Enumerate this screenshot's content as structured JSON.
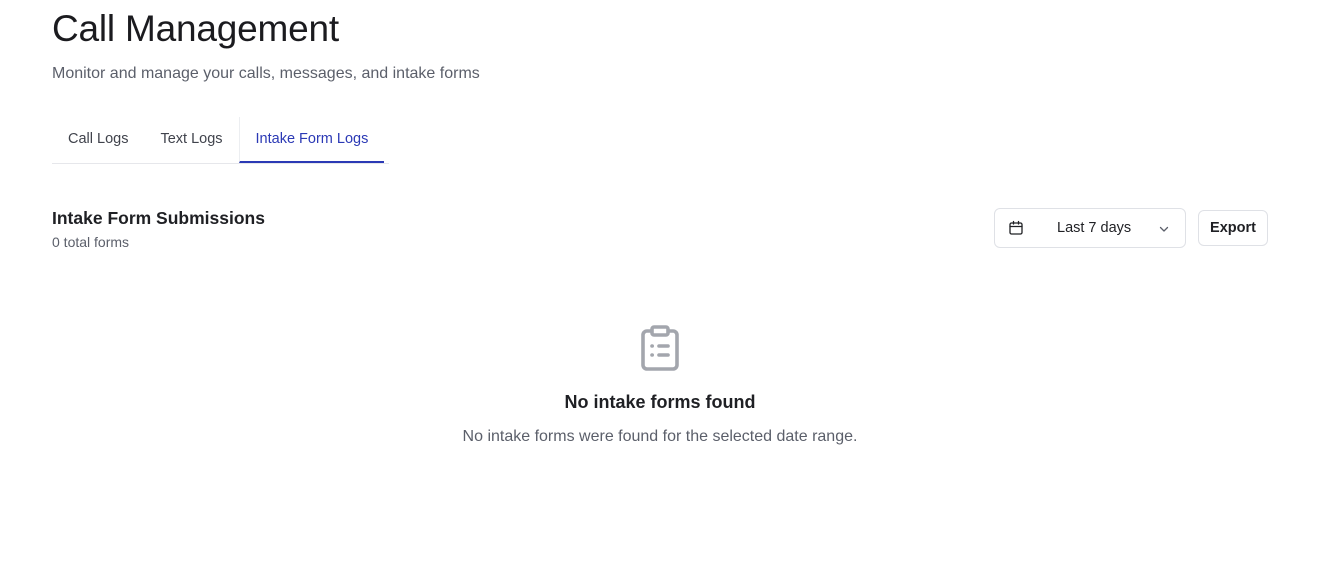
{
  "header": {
    "title": "Call Management",
    "subtitle": "Monitor and manage your calls, messages, and intake forms"
  },
  "tabs": [
    {
      "label": "Call Logs",
      "active": false
    },
    {
      "label": "Text Logs",
      "active": false
    },
    {
      "label": "Intake Form Logs",
      "active": true
    }
  ],
  "section": {
    "title": "Intake Form Submissions",
    "count_text": "0 total forms"
  },
  "date_filter": {
    "icon": "calendar-icon",
    "selected": "Last 7 days",
    "chevron": "chevron-down-icon"
  },
  "toolbar": {
    "export_label": "Export"
  },
  "empty_state": {
    "icon": "clipboard-list-icon",
    "title": "No intake forms found",
    "description": "No intake forms were found for the selected date range."
  },
  "colors": {
    "accent": "#2b39b5",
    "muted_text": "#5b5f6a",
    "border": "#dfe1e6",
    "icon_gray": "#a3a6ad"
  }
}
